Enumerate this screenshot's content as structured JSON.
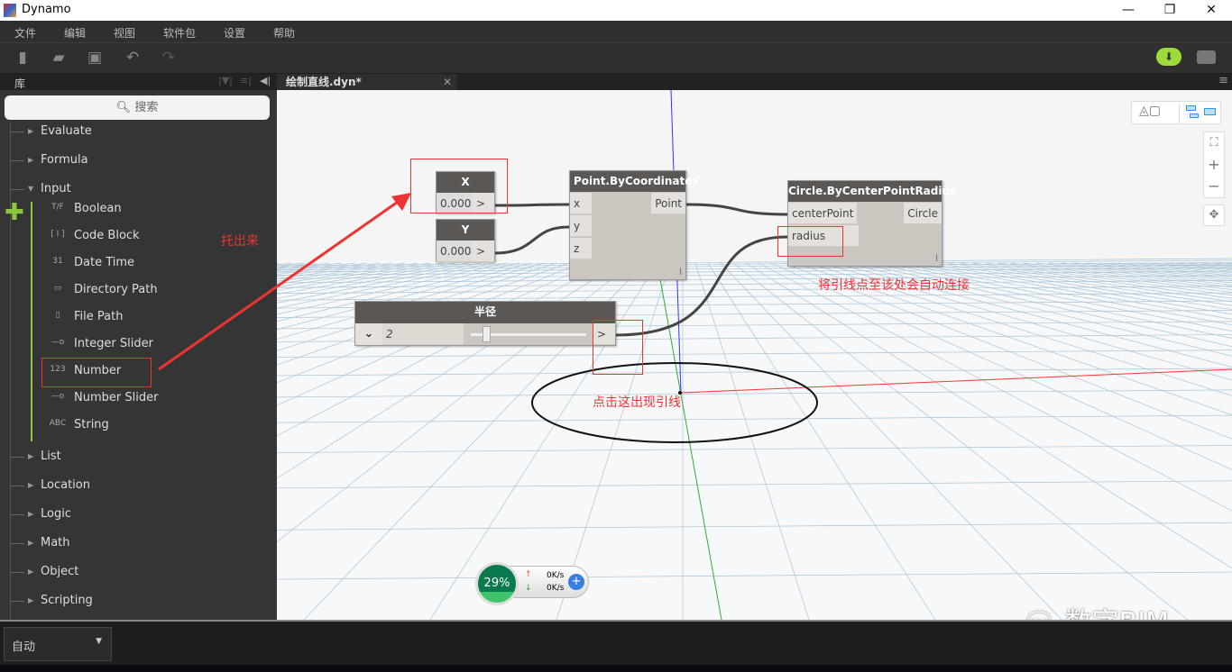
{
  "window": {
    "title": "Dynamo",
    "minimize": "—",
    "restore": "❐",
    "close": "✕"
  },
  "menu": [
    "文件",
    "编辑",
    "视图",
    "软件包",
    "设置",
    "帮助"
  ],
  "library": {
    "title": "库",
    "search_placeholder": "搜索",
    "categories_top": [
      "Evaluate",
      "Formula",
      "Input"
    ],
    "input_items": [
      {
        "label": "Boolean",
        "icon": "T/F"
      },
      {
        "label": "Code Block",
        "icon": "[ I ]"
      },
      {
        "label": "Date Time",
        "icon": "31"
      },
      {
        "label": "Directory Path",
        "icon": "▭"
      },
      {
        "label": "File Path",
        "icon": "▯"
      },
      {
        "label": "Integer Slider",
        "icon": "—o"
      },
      {
        "label": "Number",
        "icon": "123"
      },
      {
        "label": "Number Slider",
        "icon": "—o"
      },
      {
        "label": "String",
        "icon": "ABC"
      }
    ],
    "categories_bottom": [
      "List",
      "Location",
      "Logic",
      "Math",
      "Object",
      "Scripting"
    ]
  },
  "tab": {
    "label": "绘制直线.dyn*",
    "close": "✕"
  },
  "nodes": {
    "x": {
      "title": "X",
      "value": "0.000",
      "out": ">"
    },
    "y": {
      "title": "Y",
      "value": "0.000",
      "out": ">"
    },
    "point": {
      "title": "Point.ByCoordinates",
      "inputs": [
        "x",
        "y",
        "z"
      ],
      "output": "Point",
      "lacing": "l"
    },
    "circle": {
      "title": "Circle.ByCenterPointRadius",
      "inputs": [
        "centerPoint",
        "radius"
      ],
      "output": "Circle",
      "lacing": "l"
    },
    "slider": {
      "title": "半径",
      "value": "2",
      "slider_fraction": 0.1,
      "out": ">"
    }
  },
  "annotations": {
    "drag": "托出来",
    "connect": "将引线点至该处会自动连接",
    "click": "点击这出现引线"
  },
  "netmeter": {
    "percent": "29%",
    "up": "0K/s",
    "down": "0K/s"
  },
  "watermark": "数字BIM",
  "run_mode": "自动",
  "colors": {
    "accent": "#8dc63f",
    "annotation": "#e33333",
    "node_header": "#5a5755"
  }
}
